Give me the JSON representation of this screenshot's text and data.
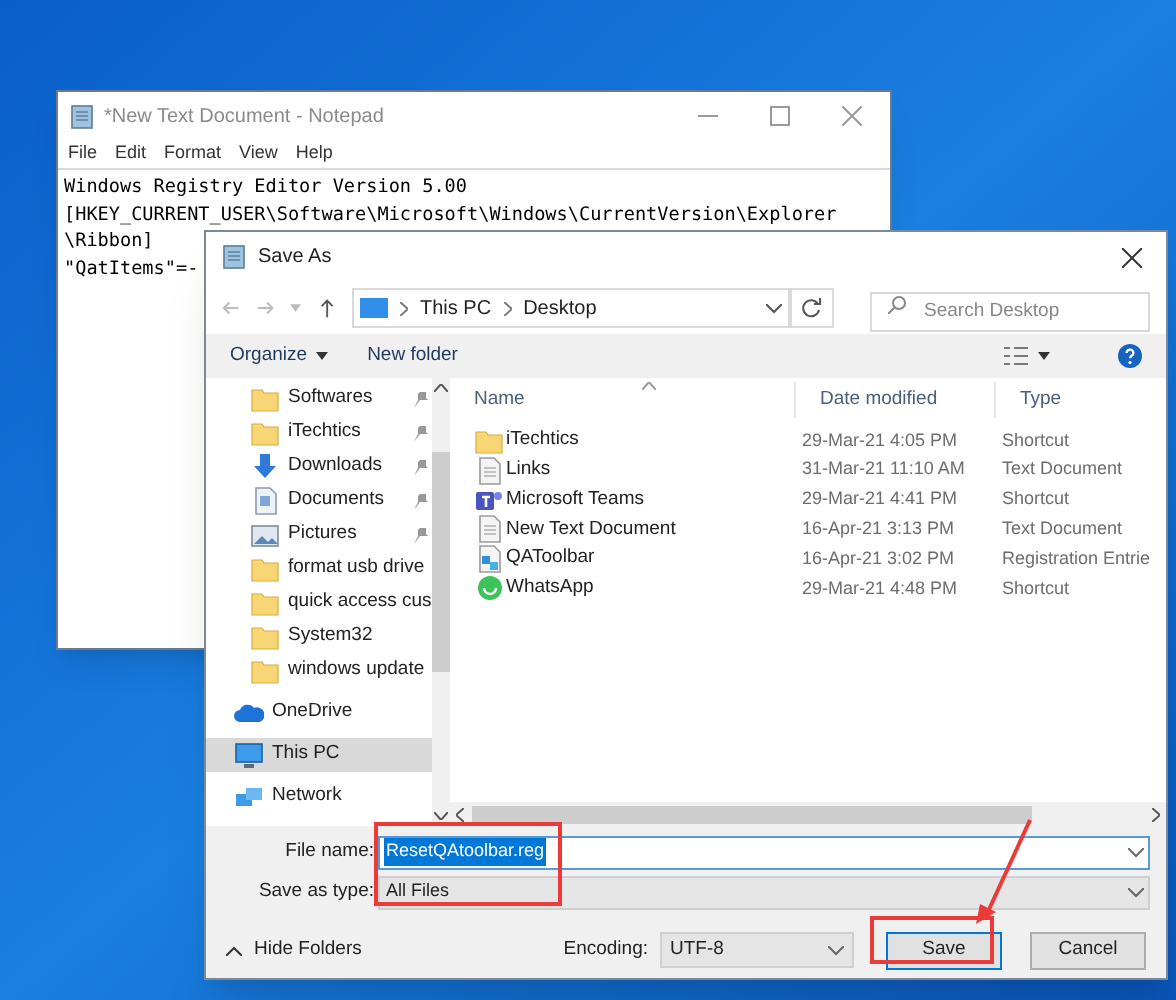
{
  "notepad": {
    "title": "*New Text Document - Notepad",
    "menu": [
      "File",
      "Edit",
      "Format",
      "View",
      "Help"
    ],
    "lines": [
      "Windows Registry Editor Version 5.00",
      "[HKEY_CURRENT_USER\\Software\\Microsoft\\Windows\\CurrentVersion\\Explorer",
      "\\Ribbon]",
      "\"QatItems\"=-"
    ]
  },
  "dialog": {
    "title": "Save As",
    "address": [
      "This PC",
      "Desktop"
    ],
    "search": {
      "placeholder": "Search Desktop"
    },
    "toolbar": [
      "Organize",
      "New folder"
    ],
    "sidebar": [
      {
        "label": "Softwares",
        "kind": "folder",
        "pinned": true,
        "selected": false
      },
      {
        "label": "iTechtics",
        "kind": "folder",
        "pinned": true,
        "selected": false
      },
      {
        "label": "Downloads",
        "kind": "download",
        "pinned": true,
        "selected": false
      },
      {
        "label": "Documents",
        "kind": "document",
        "pinned": true,
        "selected": false
      },
      {
        "label": "Pictures",
        "kind": "picture",
        "pinned": true,
        "selected": false
      },
      {
        "label": "format usb drive",
        "kind": "folder",
        "pinned": false,
        "selected": false
      },
      {
        "label": "quick access cus",
        "kind": "folder",
        "pinned": false,
        "selected": false
      },
      {
        "label": "System32",
        "kind": "folder",
        "pinned": false,
        "selected": false
      },
      {
        "label": "windows update",
        "kind": "folder",
        "pinned": false,
        "selected": false
      },
      {
        "label": "OneDrive",
        "kind": "cloud",
        "pinned": false,
        "selected": false
      },
      {
        "label": "This PC",
        "kind": "pc",
        "pinned": false,
        "selected": true
      },
      {
        "label": "Network",
        "kind": "network",
        "pinned": false,
        "selected": false
      }
    ],
    "columns": [
      "Name",
      "Date modified",
      "Type"
    ],
    "files": [
      {
        "name": "iTechtics",
        "date": "29-Mar-21 4:05 PM",
        "type": "Shortcut",
        "kind": "folder"
      },
      {
        "name": "Links",
        "date": "31-Mar-21 11:10 AM",
        "type": "Text Document",
        "kind": "text"
      },
      {
        "name": "Microsoft Teams",
        "date": "29-Mar-21 4:41 PM",
        "type": "Shortcut",
        "kind": "teams"
      },
      {
        "name": "New Text Document",
        "date": "16-Apr-21 3:13 PM",
        "type": "Text Document",
        "kind": "text"
      },
      {
        "name": "QAToolbar",
        "date": "16-Apr-21 3:02 PM",
        "type": "Registration Entrie",
        "kind": "registry"
      },
      {
        "name": "WhatsApp",
        "date": "29-Mar-21 4:48 PM",
        "type": "Shortcut",
        "kind": "chat"
      }
    ],
    "file_name": {
      "label": "File name:",
      "value": "ResetQAtoolbar.reg"
    },
    "save_type": {
      "label": "Save as type:",
      "value": "All Files"
    },
    "hide_folders": "Hide Folders",
    "encoding": {
      "label": "Encoding:",
      "value": "UTF-8"
    },
    "buttons": [
      "Save",
      "Cancel"
    ]
  }
}
